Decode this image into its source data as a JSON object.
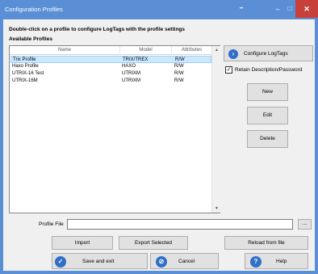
{
  "window": {
    "title": "Configuration Profiles"
  },
  "titlebar": {
    "dots": "••",
    "min": "–",
    "max": "□",
    "close": "✕"
  },
  "instructions": "Double-click on a profile to configure LogTags with the profile settings",
  "available_label": "Available Profiles",
  "profiles_table": {
    "columns": [
      "Name",
      "Model",
      "Attributes"
    ],
    "rows": [
      {
        "name": "Trix Profile",
        "model": "TRIX/TREX",
        "attributes": "R/W",
        "selected": true
      },
      {
        "name": "Haxo Profile",
        "model": "HAXO",
        "attributes": "R/W",
        "selected": false
      },
      {
        "name": "UTRIX-16 Test",
        "model": "UTRIXM",
        "attributes": "R/W",
        "selected": false
      },
      {
        "name": "UTRIX-16M",
        "model": "UTRIXM",
        "attributes": "R/W",
        "selected": false
      }
    ]
  },
  "side": {
    "configure_label": "Configure LogTags",
    "retain_label": "Retain Description/Password",
    "retain_checked": true,
    "new_label": "New",
    "edit_label": "Edit",
    "delete_label": "Delete"
  },
  "profile_file": {
    "label": "Profile File",
    "value": "",
    "browse_label": "..."
  },
  "bottom": {
    "import_label": "Import",
    "export_label": "Export Selected",
    "reload_label": "Reload from file",
    "save_label": "Save and exit",
    "cancel_label": "Cancel",
    "help_label": "Help"
  },
  "icons": {
    "configure": "chevron-right-icon",
    "save": "check-icon",
    "cancel": "cancel-icon",
    "help": "help-icon"
  }
}
